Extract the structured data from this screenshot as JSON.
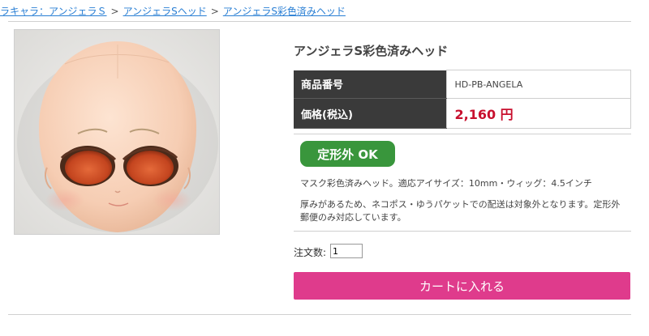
{
  "breadcrumb": {
    "items": [
      "ラキャラ：アンジェラＳ",
      "アンジェラSヘッド",
      "アンジェラS彩色済みヘッド"
    ],
    "separator": ">"
  },
  "product": {
    "title": "アンジェラS彩色済みヘッド",
    "image_alt": "doll-head-photo",
    "spec": {
      "code_label": "商品番号",
      "code_value": "HD-PB-ANGELA",
      "price_label": "価格(税込)",
      "price_value": "2,160 円"
    },
    "badge": "定形外 OK",
    "description": "マスク彩色済みヘッド。適応アイサイズ：10mm・ウィッグ：4.5インチ",
    "shipping_note": "厚みがあるため、ネコポス・ゆうパケットでの配送は対象外となります。定形外郵便のみ対応しています。"
  },
  "order": {
    "quantity_label": "注文数:",
    "quantity_value": "1",
    "cart_button": "カートに入れる"
  },
  "colors": {
    "link": "#2a7fd4",
    "price": "#c8102e",
    "badge": "#39963c",
    "cart_button": "#df3b8c",
    "spec_header": "#3a3a3a"
  }
}
